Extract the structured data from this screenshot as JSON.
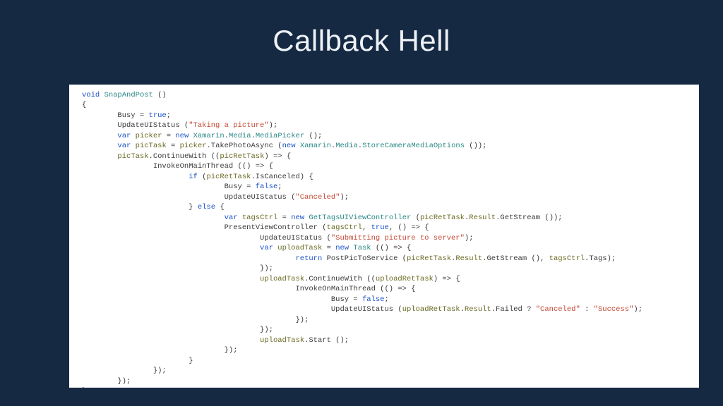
{
  "title": "Callback Hell",
  "code": {
    "l01a": "void",
    "l01b": "SnapAndPost",
    "l01c": " ()",
    "l02": "{",
    "l03a": "        Busy = ",
    "l03b": "true",
    "l03c": ";",
    "l04a": "        UpdateUIStatus (",
    "l04b": "\"Taking a picture\"",
    "l04c": ");",
    "l05a": "        ",
    "l05b": "var",
    "l05c": " ",
    "l05d": "picker",
    "l05e": " = ",
    "l05f": "new",
    "l05g": " ",
    "l05h": "Xamarin",
    "l05i": ".",
    "l05j": "Media",
    "l05k": ".",
    "l05l": "MediaPicker",
    "l05m": " ();",
    "l06a": "        ",
    "l06b": "var",
    "l06c": " ",
    "l06d": "picTask",
    "l06e": " = ",
    "l06f": "picker",
    "l06g": ".TakePhotoAsync (",
    "l06h": "new",
    "l06i": " ",
    "l06j": "Xamarin",
    "l06k": ".",
    "l06l": "Media",
    "l06m": ".",
    "l06n": "StoreCameraMediaOptions",
    "l06o": " ());",
    "l07a": "        ",
    "l07b": "picTask",
    "l07c": ".ContinueWith ((",
    "l07d": "picRetTask",
    "l07e": ") => {",
    "l08a": "                InvokeOnMainThread (() => {",
    "l09a": "                        ",
    "l09b": "if",
    "l09c": " (",
    "l09d": "picRetTask",
    "l09e": ".IsCanceled) {",
    "l10a": "                                Busy = ",
    "l10b": "false",
    "l10c": ";",
    "l11a": "                                UpdateUIStatus (",
    "l11b": "\"Canceled\"",
    "l11c": ");",
    "l12a": "                        } ",
    "l12b": "else",
    "l12c": " {",
    "l13a": "                                ",
    "l13b": "var",
    "l13c": " ",
    "l13d": "tagsCtrl",
    "l13e": " = ",
    "l13f": "new",
    "l13g": " ",
    "l13h": "GetTagsUIViewController",
    "l13i": " (",
    "l13j": "picRetTask",
    "l13k": ".",
    "l13l": "Result",
    "l13m": ".GetStream ());",
    "l14a": "                                PresentViewController (",
    "l14b": "tagsCtrl",
    "l14c": ", ",
    "l14d": "true",
    "l14e": ", () => {",
    "l15a": "                                        UpdateUIStatus (",
    "l15b": "\"Submitting picture to server\"",
    "l15c": ");",
    "l16a": "                                        ",
    "l16b": "var",
    "l16c": " ",
    "l16d": "uploadTask",
    "l16e": " = ",
    "l16f": "new",
    "l16g": " ",
    "l16h": "Task",
    "l16i": " (() => {",
    "l17a": "                                                ",
    "l17b": "return",
    "l17c": " PostPicToService (",
    "l17d": "picRetTask",
    "l17e": ".",
    "l17f": "Result",
    "l17g": ".GetStream (), ",
    "l17h": "tagsCtrl",
    "l17i": ".Tags);",
    "l18a": "                                        });",
    "l19a": "                                        ",
    "l19b": "uploadTask",
    "l19c": ".ContinueWith ((",
    "l19d": "uploadRetTask",
    "l19e": ") => {",
    "l20a": "                                                InvokeOnMainThread (() => {",
    "l21a": "                                                        Busy = ",
    "l21b": "false",
    "l21c": ";",
    "l22a": "                                                        UpdateUIStatus (",
    "l22b": "uploadRetTask",
    "l22c": ".",
    "l22d": "Result",
    "l22e": ".Failed ? ",
    "l22f": "\"Canceled\"",
    "l22g": " : ",
    "l22h": "\"Success\"",
    "l22i": ");",
    "l23a": "                                                });",
    "l24a": "                                        });",
    "l25a": "                                        ",
    "l25b": "uploadTask",
    "l25c": ".Start ();",
    "l26a": "                                });",
    "l27a": "                        }",
    "l28a": "                });",
    "l29a": "        });",
    "l30a": "}"
  }
}
